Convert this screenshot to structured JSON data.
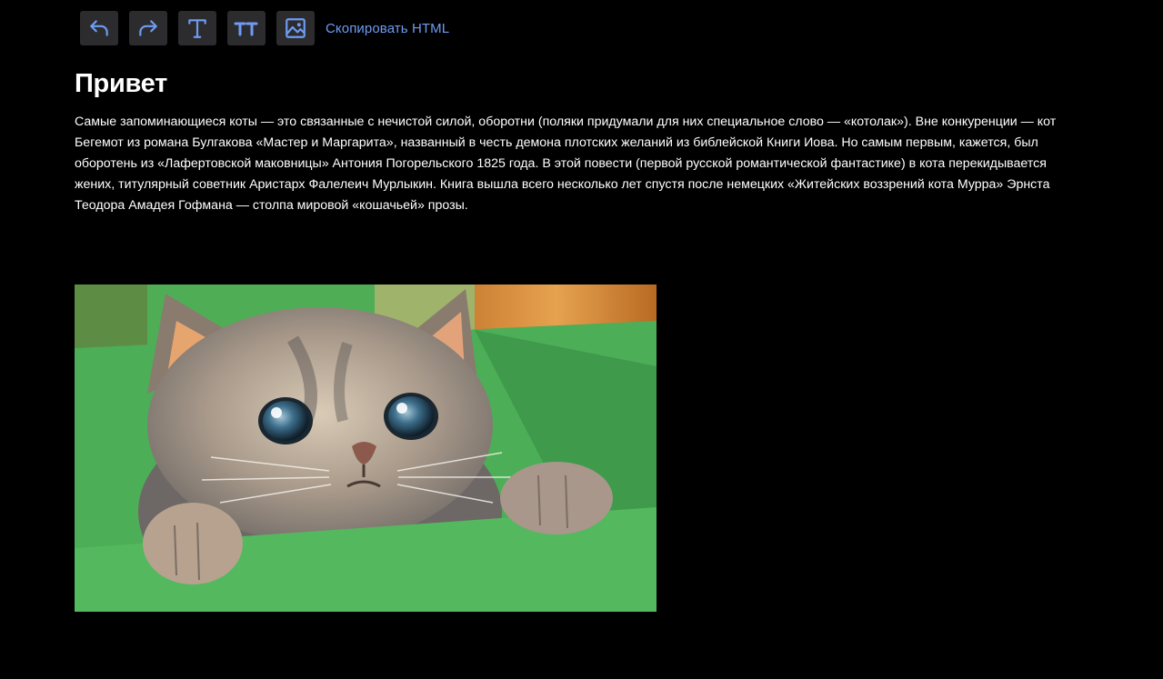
{
  "toolbar": {
    "buttons": [
      {
        "name": "undo",
        "icon": "undo-icon"
      },
      {
        "name": "redo",
        "icon": "redo-icon"
      },
      {
        "name": "text",
        "icon": "text-icon"
      },
      {
        "name": "heading",
        "icon": "heading-icon"
      },
      {
        "name": "image",
        "icon": "image-icon"
      }
    ],
    "copy_html_label": "Скопировать HTML",
    "icon_color": "#6f9cf3",
    "button_bg": "#2c2c2e"
  },
  "document": {
    "title": "Привет",
    "paragraph": "Самые запоминающиеся коты — это связанные с нечистой силой, оборотни (поляки придумали для них специальное слово — «котолак»). Вне конкуренции — кот Бегемот из романа Булгакова «Мастер и Маргарита», названный в честь демона плотских желаний из библейской Книги Иова. Но самым первым, кажется, был оборотень из «Лафертовской маковницы» Антония Погорельского 1825 года. В этой повести (первой русской романтической фантастике) в кота перекидывается жених, титулярный советник Аристарх Фалелеич Мурлыкин. Книга вышла всего несколько лет спустя после немецких «Житейских воззрений кота Мурра» Эрнста Теодора Амадея Гофмана — столпа мировой «кошачьей» прозы.",
    "image": {
      "subject": "kitten-in-green-box"
    }
  },
  "colors": {
    "background": "#000000",
    "text": "#ffffff",
    "accent": "#6f9cf3"
  }
}
